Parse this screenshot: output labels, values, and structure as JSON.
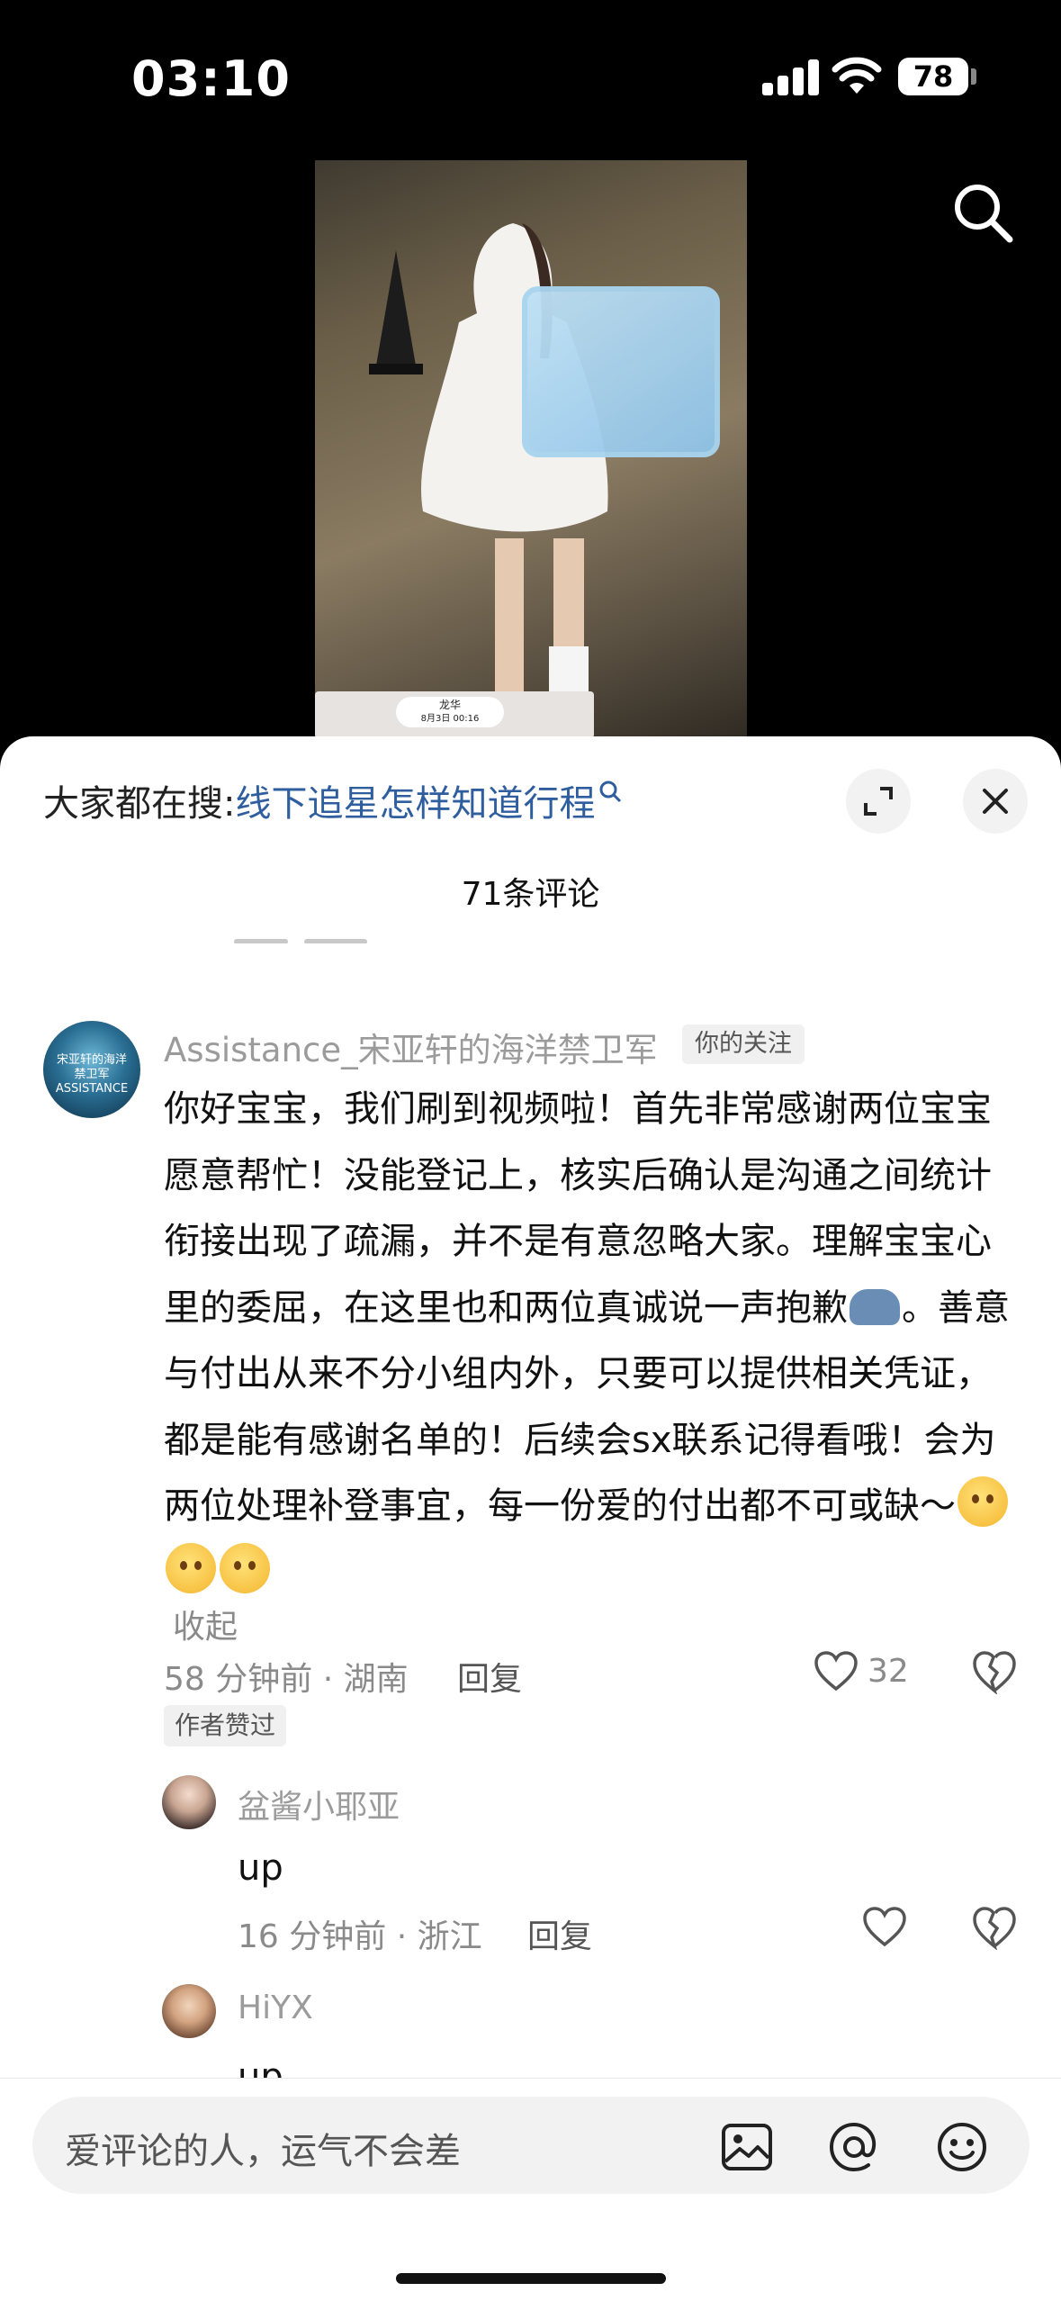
{
  "status_bar": {
    "time": "03:10",
    "battery": "78"
  },
  "video": {
    "thumb_label": "龙华",
    "thumb_sub": "8月3日 00:16"
  },
  "sheet": {
    "search_prefix": "大家都在搜:",
    "search_query": "线下追星怎样知道行程",
    "comment_count": "71条评论"
  },
  "main_comment": {
    "avatar_text": "宋亚轩的海洋禁卫军 ASSISTANCE",
    "username": "Assistance_宋亚轩的海洋禁卫军",
    "badge": "你的关注",
    "text_1": "你好宝宝，我们刷到视频啦！首先非常感谢两位宝宝愿意帮忙！没能登记上，核实后确认是沟通之间统计衔接出现了疏漏，并不是有意忽略大家。理解宝宝心里的委屈，在这里也和两位真诚说一声抱歉",
    "text_2": "。善意与付出从来不分小组内外，只要可以提供相关凭证，都是能有感谢名单的！后续会sx联系记得看哦！会为两位处理补登事宜，每一份爱的付出都不可或缺～",
    "collapse": "收起",
    "meta": "58 分钟前 · 湖南",
    "reply": "回复",
    "likes": "32",
    "author_liked": "作者赞过"
  },
  "replies": [
    {
      "name": "盆酱小耶亚",
      "text": "up",
      "meta": "16 分钟前 · 浙江",
      "reply": "回复"
    },
    {
      "name": "HiYX",
      "text": "up"
    }
  ],
  "input": {
    "placeholder": "爱评论的人，运气不会差"
  }
}
